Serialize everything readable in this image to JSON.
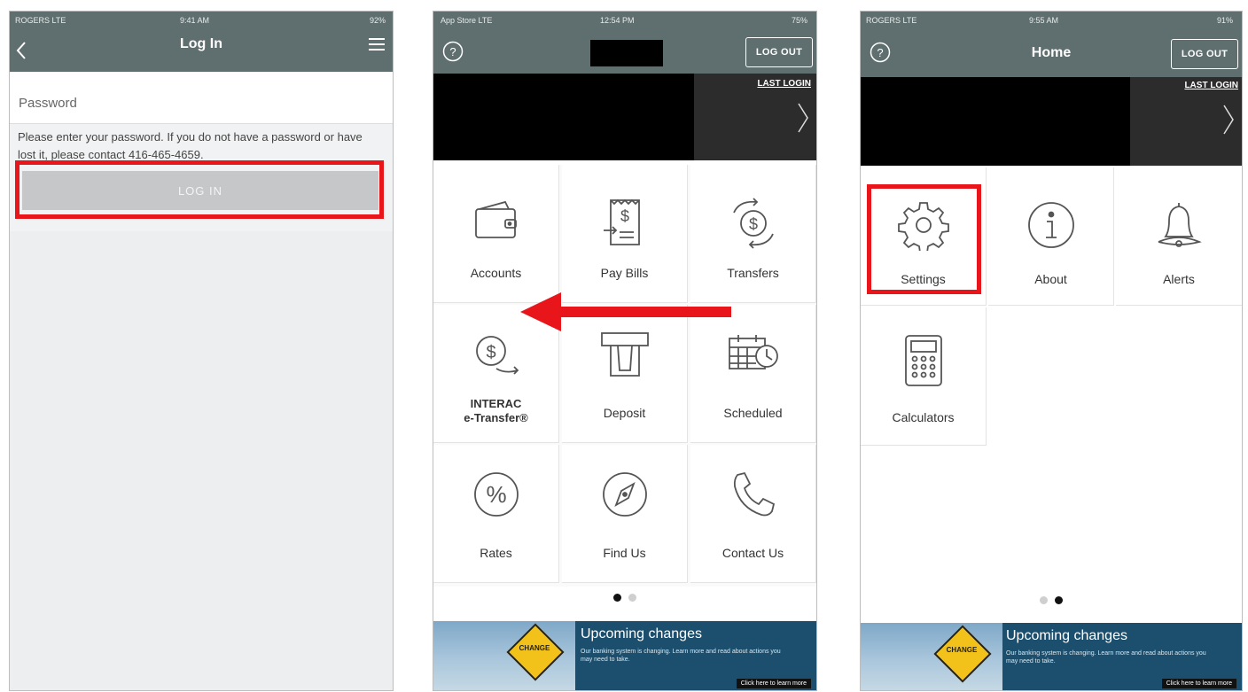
{
  "screen1": {
    "status": {
      "carrier": "ROGERS LTE",
      "time": "9:41 AM",
      "battery": "92%"
    },
    "nav_title": "Log In",
    "password_label": "Password",
    "help_text": "Please enter your password. If you do not have a password or have lost it, please contact 416-465-4659.",
    "login_button": "LOG IN"
  },
  "screen2": {
    "status": {
      "carrier": "App Store LTE",
      "time": "12:54 PM",
      "battery": "75%"
    },
    "logout": "LOG OUT",
    "last_login": "LAST LOGIN",
    "tiles": [
      {
        "label": "Accounts",
        "icon": "wallet-icon"
      },
      {
        "label": "Pay Bills",
        "icon": "bill-icon"
      },
      {
        "label": "Transfers",
        "icon": "transfer-icon"
      },
      {
        "label": "INTERAC",
        "label2": "e-Transfer®",
        "icon": "etransfer-icon"
      },
      {
        "label": "Deposit",
        "icon": "atm-icon"
      },
      {
        "label": "Scheduled",
        "icon": "calendar-clock-icon"
      },
      {
        "label": "Rates",
        "icon": "percent-icon"
      },
      {
        "label": "Find Us",
        "icon": "compass-icon"
      },
      {
        "label": "Contact Us",
        "icon": "phone-icon"
      }
    ],
    "promo_title": "Upcoming changes",
    "promo_text": "Our banking system is changing. Learn more and read about actions you may need to take.",
    "promo_cta": "Click here to learn more",
    "sign_text": "CHANGE"
  },
  "screen3": {
    "status": {
      "carrier": "ROGERS LTE",
      "time": "9:55 AM",
      "battery": "91%"
    },
    "nav_title": "Home",
    "logout": "LOG OUT",
    "last_login": "LAST LOGIN",
    "tiles": [
      {
        "label": "Settings",
        "icon": "gear-icon"
      },
      {
        "label": "About",
        "icon": "info-icon"
      },
      {
        "label": "Alerts",
        "icon": "bell-icon"
      },
      {
        "label": "Calculators",
        "icon": "calculator-icon"
      }
    ],
    "promo_title": "Upcoming changes",
    "promo_text": "Our banking system is changing. Learn more and read about actions you may need to take.",
    "promo_cta": "Click here to learn more",
    "sign_text": "CHANGE"
  },
  "colors": {
    "header": "#5f6e6f",
    "highlight": "#e8161b",
    "promo": "#1c4f6e",
    "sign": "#f2c21a"
  }
}
